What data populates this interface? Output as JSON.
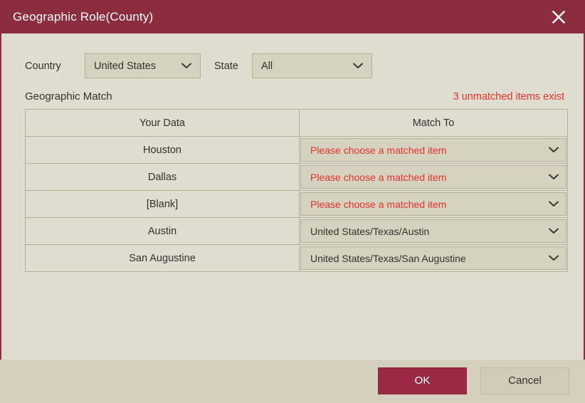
{
  "dialog": {
    "title": "Geographic Role(County)",
    "close_icon": "close-x-icon",
    "accent_color": "#8c2c3f",
    "body_color": "#dfdcd0",
    "error_color": "#e8312a"
  },
  "filters": {
    "country_label": "Country",
    "country_value": "United States",
    "state_label": "State",
    "state_value": "All",
    "chevron_icon": "chevron-down-icon"
  },
  "section": {
    "title": "Geographic Match",
    "unmatched_note": "3 unmatched items exist"
  },
  "table": {
    "headers": [
      "Your Data",
      "Match To"
    ],
    "rows": [
      {
        "your_data": "Houston",
        "match_to": "Please choose a matched item",
        "matched": false
      },
      {
        "your_data": "Dallas",
        "match_to": "Please choose a matched item",
        "matched": false
      },
      {
        "your_data": "[Blank]",
        "match_to": "Please choose a matched item",
        "matched": false
      },
      {
        "your_data": "Austin",
        "match_to": "United States/Texas/Austin",
        "matched": true
      },
      {
        "your_data": "San Augustine",
        "match_to": "United States/Texas/San Augustine",
        "matched": true
      }
    ]
  },
  "footer": {
    "ok_label": "OK",
    "cancel_label": "Cancel"
  }
}
